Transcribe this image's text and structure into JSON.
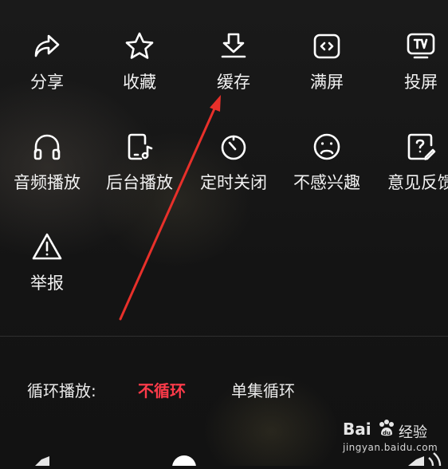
{
  "menu": {
    "items": [
      {
        "label": "分享",
        "icon": "share-icon"
      },
      {
        "label": "收藏",
        "icon": "star-icon"
      },
      {
        "label": "缓存",
        "icon": "download-icon"
      },
      {
        "label": "满屏",
        "icon": "fullscreen-icon"
      },
      {
        "label": "投屏",
        "icon": "tv-icon"
      },
      {
        "label": "音频播放",
        "icon": "headphones-icon"
      },
      {
        "label": "后台播放",
        "icon": "phone-music-icon"
      },
      {
        "label": "定时关闭",
        "icon": "timer-icon"
      },
      {
        "label": "不感兴趣",
        "icon": "sad-face-icon"
      },
      {
        "label": "意见反馈",
        "icon": "feedback-icon"
      },
      {
        "label": "举报",
        "icon": "warning-icon"
      }
    ]
  },
  "loop": {
    "label": "循环播放:",
    "options": [
      {
        "label": "不循环",
        "active": true
      },
      {
        "label": "单集循环",
        "active": false
      }
    ]
  },
  "watermark": {
    "brand": "Bai",
    "brand_cn": "经验",
    "url": "jingyan.baidu.com"
  },
  "colors": {
    "accent": "#ff3b4a",
    "annotation_arrow": "#e8302a",
    "background": "#121212"
  }
}
